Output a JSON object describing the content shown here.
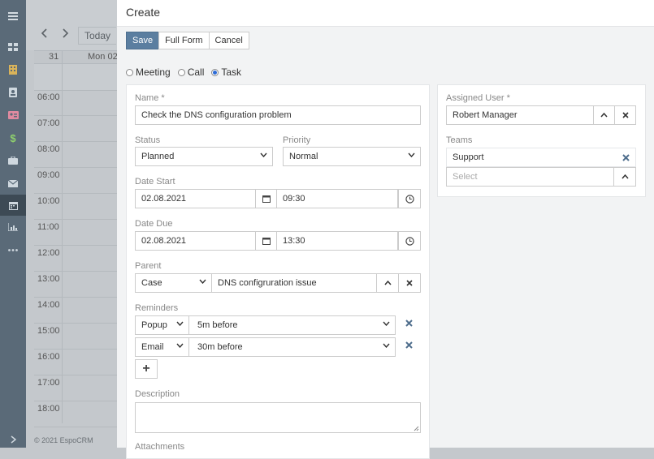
{
  "nav": {
    "icons": [
      "menu-icon",
      "dashboard-icon",
      "building-icon",
      "contact-icon",
      "card-icon",
      "dollar-icon",
      "briefcase-icon",
      "mail-icon",
      "calendar-icon",
      "chart-icon",
      "more-icon",
      "expand-icon"
    ]
  },
  "calendar": {
    "today_label": "Today",
    "header_week": "31",
    "header_day": "Mon 02",
    "hours": [
      "06:00",
      "07:00",
      "08:00",
      "09:00",
      "10:00",
      "11:00",
      "12:00",
      "13:00",
      "14:00",
      "15:00",
      "16:00",
      "17:00",
      "18:00"
    ],
    "footer": "© 2021 EspoCRM"
  },
  "modal": {
    "title": "Create",
    "buttons": {
      "save": "Save",
      "full_form": "Full Form",
      "cancel": "Cancel"
    },
    "types": {
      "meeting": "Meeting",
      "call": "Call",
      "task": "Task",
      "selected": "Task"
    },
    "name": {
      "label": "Name *",
      "value": "Check the DNS configuration problem"
    },
    "status": {
      "label": "Status",
      "value": "Planned"
    },
    "priority": {
      "label": "Priority",
      "value": "Normal"
    },
    "date_start": {
      "label": "Date Start",
      "date": "02.08.2021",
      "time": "09:30"
    },
    "date_due": {
      "label": "Date Due",
      "date": "02.08.2021",
      "time": "13:30"
    },
    "parent": {
      "label": "Parent",
      "type": "Case",
      "value": "DNS configruration issue"
    },
    "reminders": {
      "label": "Reminders",
      "items": [
        {
          "type": "Popup",
          "time": "5m before"
        },
        {
          "type": "Email",
          "time": "30m before"
        }
      ],
      "add": "+"
    },
    "description": {
      "label": "Description"
    },
    "attachments": {
      "label": "Attachments"
    },
    "assigned_user": {
      "label": "Assigned User *",
      "value": "Robert Manager"
    },
    "teams": {
      "label": "Teams",
      "items": [
        "Support"
      ],
      "placeholder": "Select"
    }
  }
}
